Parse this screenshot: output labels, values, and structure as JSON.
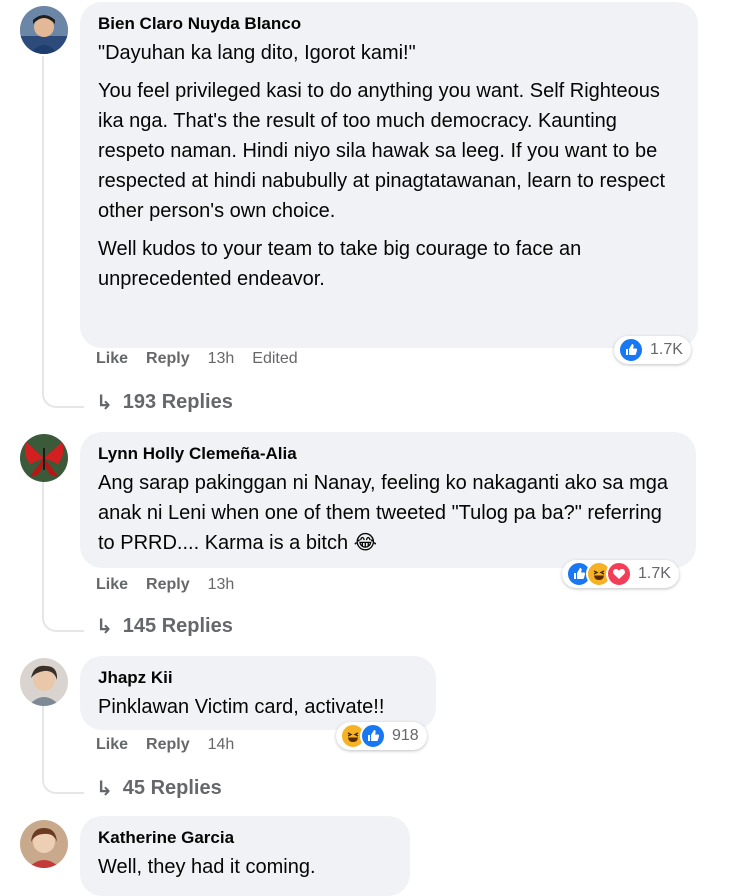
{
  "comments": [
    {
      "author": "Bien Claro Nuyda Blanco",
      "paragraphs": [
        "\"Dayuhan ka lang dito, Igorot kami!\"",
        "You feel privileged kasi to do anything you want. Self Righteous ika nga. That's the result of too much democracy. Kaunting respeto naman. Hindi niyo sila hawak sa leeg. If you want to be respected at hindi nabubully at pinagtatawanan, learn to respect other person's own choice.",
        "Well kudos to your team to take big courage to face an unprecedented endeavor."
      ],
      "like_label": "Like",
      "reply_label": "Reply",
      "time": "13h",
      "edited": "Edited",
      "reactions": [
        "like-icon"
      ],
      "reaction_count": "1.7K",
      "replies": "193 Replies"
    },
    {
      "author": "Lynn Holly Clemeña-Alia",
      "paragraphs": [
        "Ang sarap pakinggan ni Nanay, feeling ko nakaganti ako sa mga anak ni Leni when one of them tweeted \"Tulog pa ba?\" referring to PRRD.... Karma is a bitch 😂"
      ],
      "like_label": "Like",
      "reply_label": "Reply",
      "time": "13h",
      "reactions": [
        "like-icon",
        "haha-icon",
        "love-icon"
      ],
      "reaction_count": "1.7K",
      "replies": "145 Replies"
    },
    {
      "author": "Jhapz Kii",
      "paragraphs": [
        "Pinklawan Victim card, activate!!"
      ],
      "like_label": "Like",
      "reply_label": "Reply",
      "time": "14h",
      "reactions": [
        "haha-icon",
        "like-icon"
      ],
      "reaction_count": "918",
      "replies": "45 Replies"
    },
    {
      "author": "Katherine Garcia",
      "paragraphs": [
        "Well, they had it coming."
      ]
    }
  ],
  "colors": {
    "bubble": "#f0f2f5",
    "meta_text": "#65676b",
    "like_blue": "#1877f2",
    "haha_yellow": "#f7b125",
    "love_red": "#f33e58"
  }
}
